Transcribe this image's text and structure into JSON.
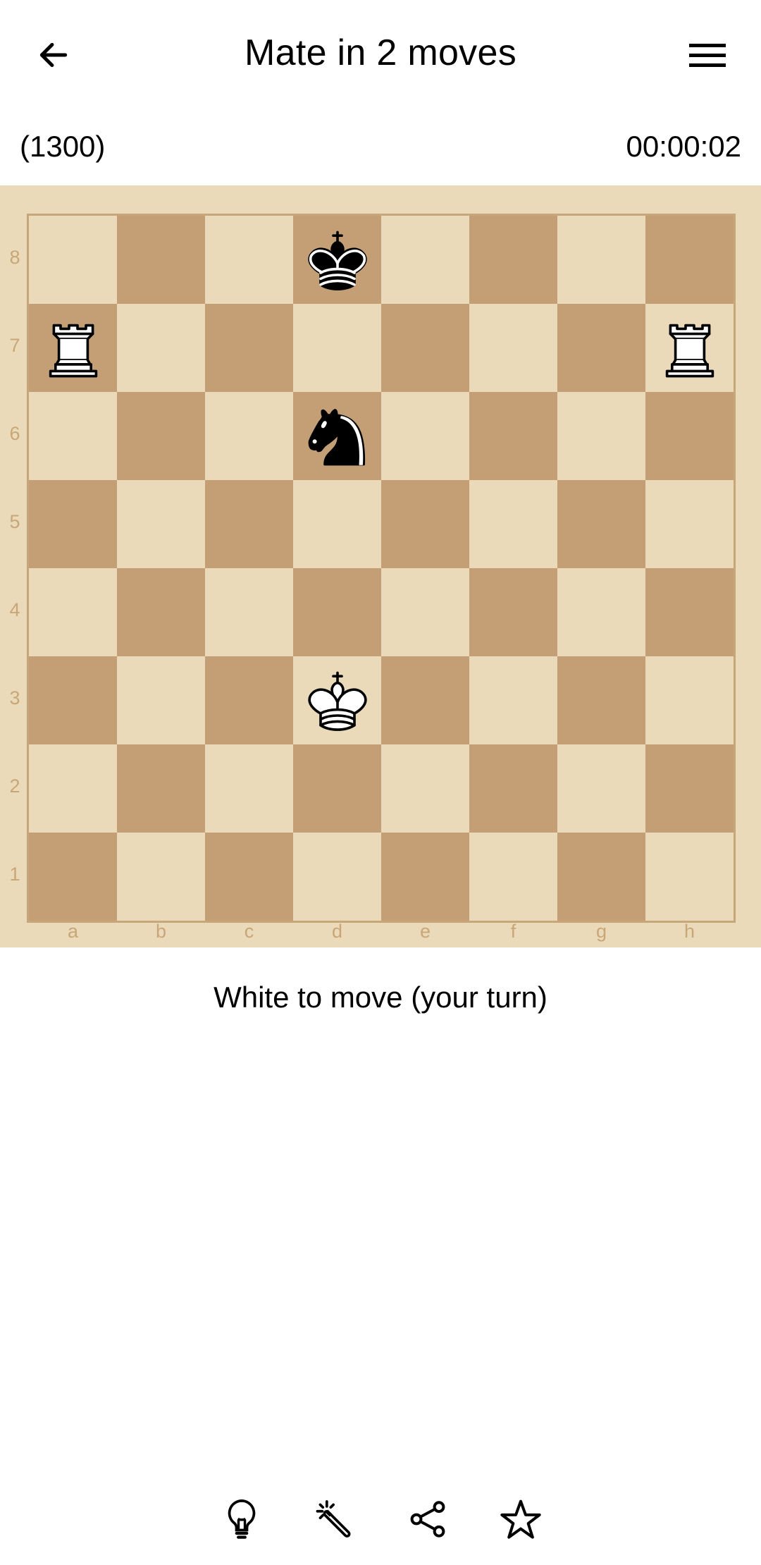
{
  "header": {
    "title": "Mate in 2 moves",
    "back_icon": "arrow-left-icon",
    "menu_icon": "hamburger-menu-icon"
  },
  "info": {
    "rating": "(1300)",
    "timer": "00:00:02"
  },
  "board": {
    "colors": {
      "light": "#EBDAB9",
      "dark": "#C49F75",
      "label": "#C9A677"
    },
    "ranks": [
      "8",
      "7",
      "6",
      "5",
      "4",
      "3",
      "2",
      "1"
    ],
    "files": [
      "a",
      "b",
      "c",
      "d",
      "e",
      "f",
      "g",
      "h"
    ],
    "pieces": [
      {
        "square": "d8",
        "color": "black",
        "type": "king"
      },
      {
        "square": "a7",
        "color": "white",
        "type": "rook"
      },
      {
        "square": "h7",
        "color": "white",
        "type": "rook"
      },
      {
        "square": "d6",
        "color": "black",
        "type": "knight"
      },
      {
        "square": "d3",
        "color": "white",
        "type": "king"
      }
    ]
  },
  "status": "White to move (your turn)",
  "toolbar": [
    {
      "name": "hint",
      "icon": "lightbulb-icon"
    },
    {
      "name": "magic-wand",
      "icon": "magic-wand-icon"
    },
    {
      "name": "share",
      "icon": "share-icon"
    },
    {
      "name": "favorite",
      "icon": "star-outline-icon"
    }
  ]
}
